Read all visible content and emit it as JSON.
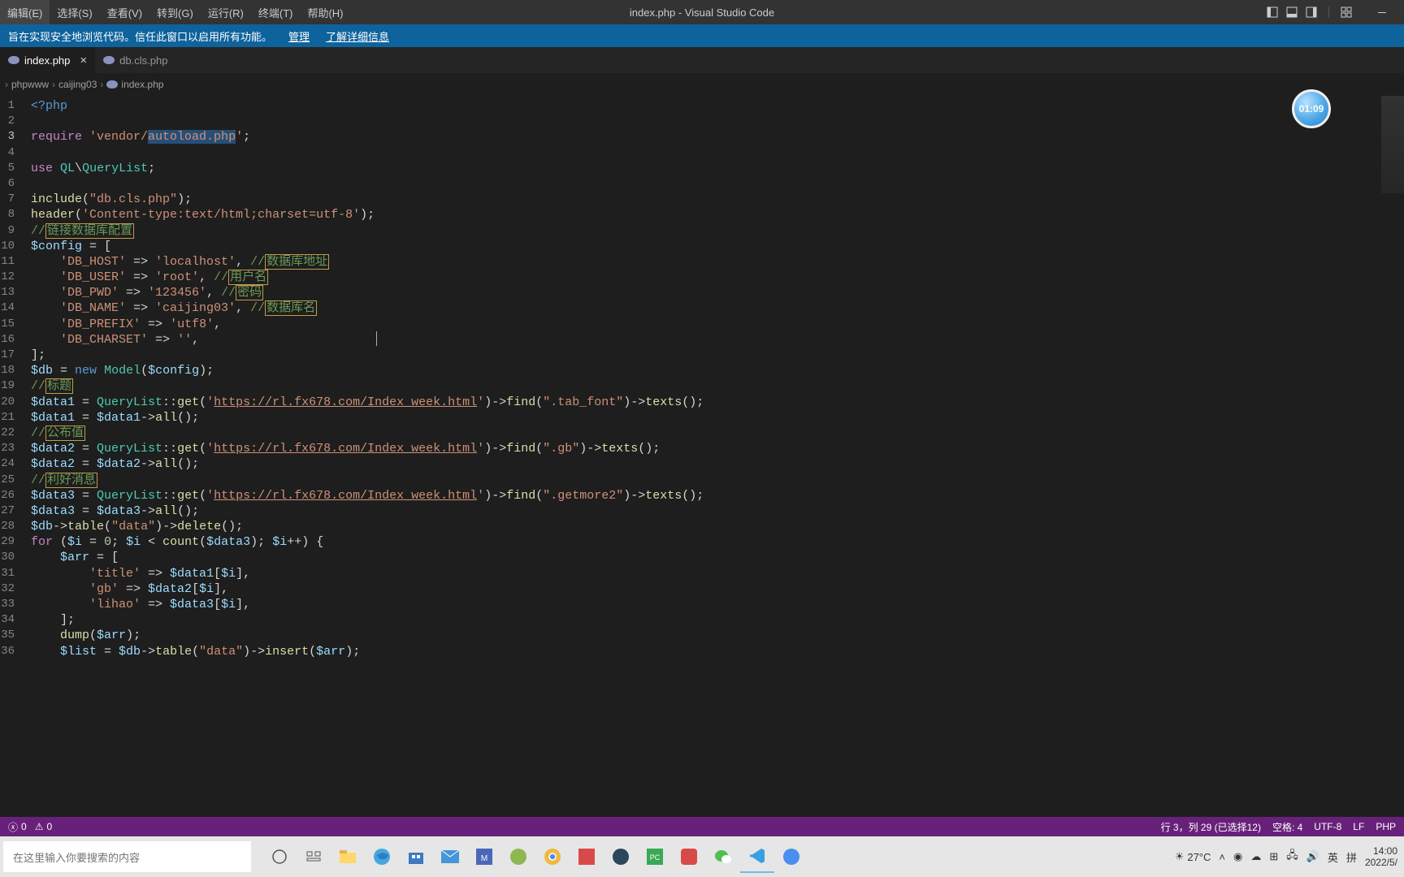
{
  "menubar": {
    "items": [
      "编辑(E)",
      "选择(S)",
      "查看(V)",
      "转到(G)",
      "运行(R)",
      "终端(T)",
      "帮助(H)"
    ],
    "title": "index.php - Visual Studio Code"
  },
  "notification": {
    "text": "旨在实现安全地浏览代码。信任此窗口以启用所有功能。",
    "manage": "管理",
    "learn": "了解详细信息"
  },
  "tabs": [
    {
      "name": "index.php",
      "active": true
    },
    {
      "name": "db.cls.php",
      "active": false
    }
  ],
  "breadcrumbs": [
    "phpwww",
    "caijing03",
    "index.php"
  ],
  "code_lines": [
    {
      "n": 1,
      "tokens": [
        {
          "c": "tk-php",
          "t": "<?php"
        }
      ]
    },
    {
      "n": 2,
      "tokens": []
    },
    {
      "n": 3,
      "active": true,
      "tokens": [
        {
          "c": "tk-kw",
          "t": "require"
        },
        {
          "c": "tk-punc",
          "t": " "
        },
        {
          "c": "tk-str",
          "t": "'vendor/"
        },
        {
          "c": "tk-str sel-bg",
          "t": "autoload.php"
        },
        {
          "c": "tk-str",
          "t": "'"
        },
        {
          "c": "tk-punc",
          "t": ";"
        }
      ]
    },
    {
      "n": 4,
      "tokens": []
    },
    {
      "n": 5,
      "tokens": [
        {
          "c": "tk-kw",
          "t": "use"
        },
        {
          "c": "tk-punc",
          "t": " "
        },
        {
          "c": "tk-ns",
          "t": "QL"
        },
        {
          "c": "tk-punc",
          "t": "\\"
        },
        {
          "c": "tk-ns",
          "t": "QueryList"
        },
        {
          "c": "tk-punc",
          "t": ";"
        }
      ]
    },
    {
      "n": 6,
      "tokens": []
    },
    {
      "n": 7,
      "tokens": [
        {
          "c": "tk-fn",
          "t": "include"
        },
        {
          "c": "tk-punc",
          "t": "("
        },
        {
          "c": "tk-str",
          "t": "\"db.cls.php\""
        },
        {
          "c": "tk-punc",
          "t": ");"
        }
      ]
    },
    {
      "n": 8,
      "tokens": [
        {
          "c": "tk-fn",
          "t": "header"
        },
        {
          "c": "tk-punc",
          "t": "("
        },
        {
          "c": "tk-str",
          "t": "'Content-type:text/html;charset=utf-8'"
        },
        {
          "c": "tk-punc",
          "t": ");"
        }
      ]
    },
    {
      "n": 9,
      "tokens": [
        {
          "c": "tk-com",
          "t": "//"
        },
        {
          "c": "tk-com highlight-box",
          "t": "链接数据库配置"
        }
      ]
    },
    {
      "n": 10,
      "tokens": [
        {
          "c": "tk-var",
          "t": "$config"
        },
        {
          "c": "tk-punc",
          "t": " = ["
        }
      ]
    },
    {
      "n": 11,
      "tokens": [
        {
          "c": "tk-punc",
          "t": "    "
        },
        {
          "c": "tk-str",
          "t": "'DB_HOST'"
        },
        {
          "c": "tk-punc",
          "t": " => "
        },
        {
          "c": "tk-str",
          "t": "'localhost'"
        },
        {
          "c": "tk-punc",
          "t": ", "
        },
        {
          "c": "tk-com",
          "t": "//"
        },
        {
          "c": "tk-com highlight-box",
          "t": "数据库地址"
        }
      ]
    },
    {
      "n": 12,
      "tokens": [
        {
          "c": "tk-punc",
          "t": "    "
        },
        {
          "c": "tk-str",
          "t": "'DB_USER'"
        },
        {
          "c": "tk-punc",
          "t": " => "
        },
        {
          "c": "tk-str",
          "t": "'root'"
        },
        {
          "c": "tk-punc",
          "t": ", "
        },
        {
          "c": "tk-com",
          "t": "//"
        },
        {
          "c": "tk-com highlight-box",
          "t": "用户名"
        }
      ]
    },
    {
      "n": 13,
      "tokens": [
        {
          "c": "tk-punc",
          "t": "    "
        },
        {
          "c": "tk-str",
          "t": "'DB_PWD'"
        },
        {
          "c": "tk-punc",
          "t": " => "
        },
        {
          "c": "tk-str",
          "t": "'123456'"
        },
        {
          "c": "tk-punc",
          "t": ", "
        },
        {
          "c": "tk-com",
          "t": "//"
        },
        {
          "c": "tk-com highlight-box",
          "t": "密码"
        }
      ]
    },
    {
      "n": 14,
      "tokens": [
        {
          "c": "tk-punc",
          "t": "    "
        },
        {
          "c": "tk-str",
          "t": "'DB_NAME'"
        },
        {
          "c": "tk-punc",
          "t": " => "
        },
        {
          "c": "tk-str",
          "t": "'caijing03'"
        },
        {
          "c": "tk-punc",
          "t": ", "
        },
        {
          "c": "tk-com",
          "t": "//"
        },
        {
          "c": "tk-com highlight-box",
          "t": "数据库名"
        }
      ]
    },
    {
      "n": 15,
      "tokens": [
        {
          "c": "tk-punc",
          "t": "    "
        },
        {
          "c": "tk-str",
          "t": "'DB_PREFIX'"
        },
        {
          "c": "tk-punc",
          "t": " => "
        },
        {
          "c": "tk-str",
          "t": "'utf8'"
        },
        {
          "c": "tk-punc",
          "t": ","
        }
      ]
    },
    {
      "n": 16,
      "tokens": [
        {
          "c": "tk-punc",
          "t": "    "
        },
        {
          "c": "tk-str",
          "t": "'DB_CHARSET'"
        },
        {
          "c": "tk-punc",
          "t": " => "
        },
        {
          "c": "tk-str",
          "t": "''"
        },
        {
          "c": "tk-punc",
          "t": ","
        }
      ]
    },
    {
      "n": 17,
      "tokens": [
        {
          "c": "tk-punc",
          "t": "];"
        }
      ]
    },
    {
      "n": 18,
      "tokens": [
        {
          "c": "tk-var",
          "t": "$db"
        },
        {
          "c": "tk-punc",
          "t": " = "
        },
        {
          "c": "tk-const",
          "t": "new"
        },
        {
          "c": "tk-punc",
          "t": " "
        },
        {
          "c": "tk-ns",
          "t": "Model"
        },
        {
          "c": "tk-punc",
          "t": "("
        },
        {
          "c": "tk-var",
          "t": "$config"
        },
        {
          "c": "tk-punc",
          "t": ");"
        }
      ]
    },
    {
      "n": 19,
      "tokens": [
        {
          "c": "tk-com",
          "t": "//"
        },
        {
          "c": "tk-com highlight-box",
          "t": "标题"
        }
      ]
    },
    {
      "n": 20,
      "tokens": [
        {
          "c": "tk-var",
          "t": "$data1"
        },
        {
          "c": "tk-punc",
          "t": " = "
        },
        {
          "c": "tk-ns",
          "t": "QueryList"
        },
        {
          "c": "tk-punc",
          "t": "::"
        },
        {
          "c": "tk-fn",
          "t": "get"
        },
        {
          "c": "tk-punc",
          "t": "("
        },
        {
          "c": "tk-str",
          "t": "'"
        },
        {
          "c": "tk-str underline-link",
          "t": "https://rl.fx678.com/Index_week.html"
        },
        {
          "c": "tk-str",
          "t": "'"
        },
        {
          "c": "tk-punc",
          "t": ")->"
        },
        {
          "c": "tk-fn",
          "t": "find"
        },
        {
          "c": "tk-punc",
          "t": "("
        },
        {
          "c": "tk-str",
          "t": "\".tab_font\""
        },
        {
          "c": "tk-punc",
          "t": ")->"
        },
        {
          "c": "tk-fn",
          "t": "texts"
        },
        {
          "c": "tk-punc",
          "t": "();"
        }
      ]
    },
    {
      "n": 21,
      "tokens": [
        {
          "c": "tk-var",
          "t": "$data1"
        },
        {
          "c": "tk-punc",
          "t": " = "
        },
        {
          "c": "tk-var",
          "t": "$data1"
        },
        {
          "c": "tk-punc",
          "t": "->"
        },
        {
          "c": "tk-fn",
          "t": "all"
        },
        {
          "c": "tk-punc",
          "t": "();"
        }
      ]
    },
    {
      "n": 22,
      "tokens": [
        {
          "c": "tk-com",
          "t": "//"
        },
        {
          "c": "tk-com highlight-box",
          "t": "公布值"
        }
      ]
    },
    {
      "n": 23,
      "tokens": [
        {
          "c": "tk-var",
          "t": "$data2"
        },
        {
          "c": "tk-punc",
          "t": " = "
        },
        {
          "c": "tk-ns",
          "t": "QueryList"
        },
        {
          "c": "tk-punc",
          "t": "::"
        },
        {
          "c": "tk-fn",
          "t": "get"
        },
        {
          "c": "tk-punc",
          "t": "("
        },
        {
          "c": "tk-str",
          "t": "'"
        },
        {
          "c": "tk-str underline-link",
          "t": "https://rl.fx678.com/Index_week.html"
        },
        {
          "c": "tk-str",
          "t": "'"
        },
        {
          "c": "tk-punc",
          "t": ")->"
        },
        {
          "c": "tk-fn",
          "t": "find"
        },
        {
          "c": "tk-punc",
          "t": "("
        },
        {
          "c": "tk-str",
          "t": "\".gb\""
        },
        {
          "c": "tk-punc",
          "t": ")->"
        },
        {
          "c": "tk-fn",
          "t": "texts"
        },
        {
          "c": "tk-punc",
          "t": "();"
        }
      ]
    },
    {
      "n": 24,
      "tokens": [
        {
          "c": "tk-var",
          "t": "$data2"
        },
        {
          "c": "tk-punc",
          "t": " = "
        },
        {
          "c": "tk-var",
          "t": "$data2"
        },
        {
          "c": "tk-punc",
          "t": "->"
        },
        {
          "c": "tk-fn",
          "t": "all"
        },
        {
          "c": "tk-punc",
          "t": "();"
        }
      ]
    },
    {
      "n": 25,
      "tokens": [
        {
          "c": "tk-com",
          "t": "//"
        },
        {
          "c": "tk-com highlight-box",
          "t": "利好消息"
        }
      ]
    },
    {
      "n": 26,
      "tokens": [
        {
          "c": "tk-var",
          "t": "$data3"
        },
        {
          "c": "tk-punc",
          "t": " = "
        },
        {
          "c": "tk-ns",
          "t": "QueryList"
        },
        {
          "c": "tk-punc",
          "t": "::"
        },
        {
          "c": "tk-fn",
          "t": "get"
        },
        {
          "c": "tk-punc",
          "t": "("
        },
        {
          "c": "tk-str",
          "t": "'"
        },
        {
          "c": "tk-str underline-link",
          "t": "https://rl.fx678.com/Index_week.html"
        },
        {
          "c": "tk-str",
          "t": "'"
        },
        {
          "c": "tk-punc",
          "t": ")->"
        },
        {
          "c": "tk-fn",
          "t": "find"
        },
        {
          "c": "tk-punc",
          "t": "("
        },
        {
          "c": "tk-str",
          "t": "\".getmore2\""
        },
        {
          "c": "tk-punc",
          "t": ")->"
        },
        {
          "c": "tk-fn",
          "t": "texts"
        },
        {
          "c": "tk-punc",
          "t": "();"
        }
      ]
    },
    {
      "n": 27,
      "tokens": [
        {
          "c": "tk-var",
          "t": "$data3"
        },
        {
          "c": "tk-punc",
          "t": " = "
        },
        {
          "c": "tk-var",
          "t": "$data3"
        },
        {
          "c": "tk-punc",
          "t": "->"
        },
        {
          "c": "tk-fn",
          "t": "all"
        },
        {
          "c": "tk-punc",
          "t": "();"
        }
      ]
    },
    {
      "n": 28,
      "tokens": [
        {
          "c": "tk-var",
          "t": "$db"
        },
        {
          "c": "tk-punc",
          "t": "->"
        },
        {
          "c": "tk-fn",
          "t": "table"
        },
        {
          "c": "tk-punc",
          "t": "("
        },
        {
          "c": "tk-str",
          "t": "\"data\""
        },
        {
          "c": "tk-punc",
          "t": ")->"
        },
        {
          "c": "tk-fn",
          "t": "delete"
        },
        {
          "c": "tk-punc",
          "t": "();"
        }
      ]
    },
    {
      "n": 29,
      "tokens": [
        {
          "c": "tk-kw",
          "t": "for"
        },
        {
          "c": "tk-punc",
          "t": " ("
        },
        {
          "c": "tk-var",
          "t": "$i"
        },
        {
          "c": "tk-punc",
          "t": " = "
        },
        {
          "c": "tk-num",
          "t": "0"
        },
        {
          "c": "tk-punc",
          "t": "; "
        },
        {
          "c": "tk-var",
          "t": "$i"
        },
        {
          "c": "tk-punc",
          "t": " < "
        },
        {
          "c": "tk-fn",
          "t": "count"
        },
        {
          "c": "tk-punc",
          "t": "("
        },
        {
          "c": "tk-var",
          "t": "$data3"
        },
        {
          "c": "tk-punc",
          "t": "); "
        },
        {
          "c": "tk-var",
          "t": "$i"
        },
        {
          "c": "tk-punc",
          "t": "++) {"
        }
      ]
    },
    {
      "n": 30,
      "tokens": [
        {
          "c": "tk-punc",
          "t": "    "
        },
        {
          "c": "tk-var",
          "t": "$arr"
        },
        {
          "c": "tk-punc",
          "t": " = ["
        }
      ]
    },
    {
      "n": 31,
      "tokens": [
        {
          "c": "tk-punc",
          "t": "        "
        },
        {
          "c": "tk-str",
          "t": "'title'"
        },
        {
          "c": "tk-punc",
          "t": " => "
        },
        {
          "c": "tk-var",
          "t": "$data1"
        },
        {
          "c": "tk-punc",
          "t": "["
        },
        {
          "c": "tk-var",
          "t": "$i"
        },
        {
          "c": "tk-punc",
          "t": "],"
        }
      ]
    },
    {
      "n": 32,
      "tokens": [
        {
          "c": "tk-punc",
          "t": "        "
        },
        {
          "c": "tk-str",
          "t": "'gb'"
        },
        {
          "c": "tk-punc",
          "t": " => "
        },
        {
          "c": "tk-var",
          "t": "$data2"
        },
        {
          "c": "tk-punc",
          "t": "["
        },
        {
          "c": "tk-var",
          "t": "$i"
        },
        {
          "c": "tk-punc",
          "t": "],"
        }
      ]
    },
    {
      "n": 33,
      "tokens": [
        {
          "c": "tk-punc",
          "t": "        "
        },
        {
          "c": "tk-str",
          "t": "'lihao'"
        },
        {
          "c": "tk-punc",
          "t": " => "
        },
        {
          "c": "tk-var",
          "t": "$data3"
        },
        {
          "c": "tk-punc",
          "t": "["
        },
        {
          "c": "tk-var",
          "t": "$i"
        },
        {
          "c": "tk-punc",
          "t": "],"
        }
      ]
    },
    {
      "n": 34,
      "tokens": [
        {
          "c": "tk-punc",
          "t": "    ];"
        }
      ]
    },
    {
      "n": 35,
      "tokens": [
        {
          "c": "tk-punc",
          "t": "    "
        },
        {
          "c": "tk-fn",
          "t": "dump"
        },
        {
          "c": "tk-punc",
          "t": "("
        },
        {
          "c": "tk-var",
          "t": "$arr"
        },
        {
          "c": "tk-punc",
          "t": ");"
        }
      ]
    },
    {
      "n": 36,
      "tokens": [
        {
          "c": "tk-punc",
          "t": "    "
        },
        {
          "c": "tk-var",
          "t": "$list"
        },
        {
          "c": "tk-punc",
          "t": " = "
        },
        {
          "c": "tk-var",
          "t": "$db"
        },
        {
          "c": "tk-punc",
          "t": "->"
        },
        {
          "c": "tk-fn",
          "t": "table"
        },
        {
          "c": "tk-punc",
          "t": "("
        },
        {
          "c": "tk-str",
          "t": "\"data\""
        },
        {
          "c": "tk-punc",
          "t": ")->"
        },
        {
          "c": "tk-fn",
          "t": "insert"
        },
        {
          "c": "tk-punc",
          "t": "("
        },
        {
          "c": "tk-var",
          "t": "$arr"
        },
        {
          "c": "tk-punc",
          "t": ");"
        }
      ]
    }
  ],
  "statusbar": {
    "errors": "0",
    "warnings": "0",
    "position": "行 3，列 29 (已选择12)",
    "spaces": "空格: 4",
    "encoding": "UTF-8",
    "eol": "LF",
    "language": "PHP"
  },
  "timer": "01:09",
  "taskbar": {
    "search_placeholder": "在这里输入你要搜索的内容",
    "temp": "27°C",
    "ime1": "英",
    "ime2": "拼",
    "time": "14:00",
    "date": "2022/5/"
  }
}
